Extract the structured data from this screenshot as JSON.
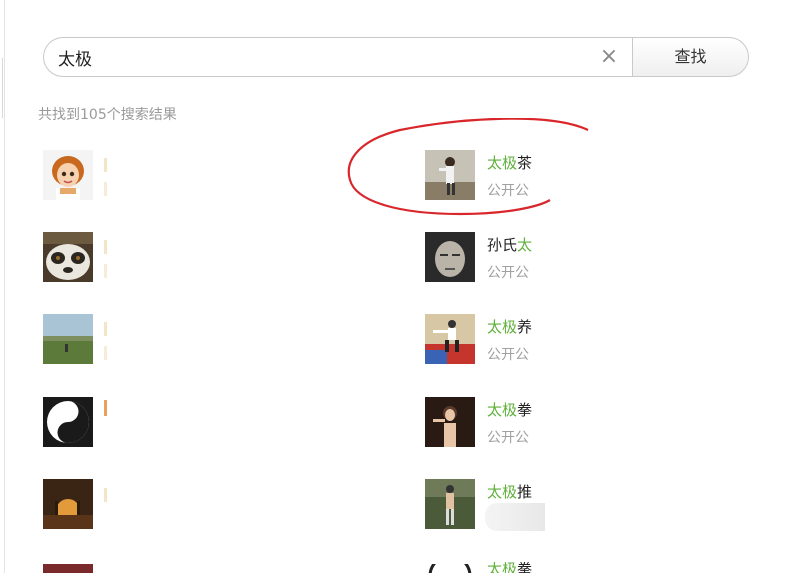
{
  "search": {
    "value": "太极",
    "clear_icon": "×",
    "button_label": "查找"
  },
  "summary": {
    "text": "共找到105个搜索结果"
  },
  "results_right": [
    {
      "hl": "太极",
      "rest": "茶",
      "sub": "公开公"
    },
    {
      "pre": "孙氏",
      "hl": "太",
      "sub": "公开公"
    },
    {
      "hl": "太极",
      "rest": "养",
      "sub": "公开公"
    },
    {
      "hl": "太极",
      "rest": "拳",
      "sub": "公开公"
    },
    {
      "hl": "太极",
      "rest": "推",
      "sub": ""
    },
    {
      "hl": "太极",
      "rest": "拳",
      "sub": ""
    }
  ],
  "colors": {
    "highlight": "#5eb13a",
    "annotation": "#d9262b"
  }
}
